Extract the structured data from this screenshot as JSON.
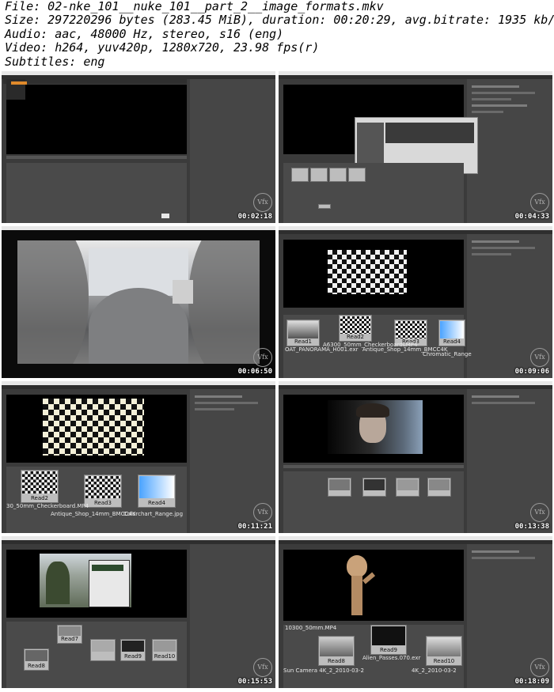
{
  "header": {
    "file": "File: 02-nke_101__nuke_101__part_2__image_formats.mkv",
    "size": "Size: 297220296 bytes (283.45 MiB), duration: 00:20:29, avg.bitrate: 1935 kb/s",
    "audio": "Audio: aac, 48000 Hz, stereo, s16 (eng)",
    "video": "Video: h264, yuv420p, 1280x720, 23.98 fps(r)",
    "subtitles": "Subtitles: eng"
  },
  "logo_text": "Vfx",
  "frames": [
    {
      "timestamp": "00:02:18"
    },
    {
      "timestamp": "00:04:33"
    },
    {
      "timestamp": "00:06:50"
    },
    {
      "timestamp": "00:09:06",
      "nodes": [
        "Read1",
        "Read2",
        "Read3",
        "Read4"
      ],
      "node_files": [
        "OAT_PANORAMA_H001.exr",
        "A6300_50mm_CheckerboardLMP4",
        "Antique_Shop_14mm_BMCC4K",
        "Chromatic_Range"
      ]
    },
    {
      "timestamp": "00:11:21",
      "nodes": [
        "Read2",
        "Read3",
        "Read4"
      ],
      "node_files": [
        "30_50mm_Checkerboard.MP4",
        "Antique_Shop_14mm_BMCC4K",
        "Colorchart_Range.jpg"
      ]
    },
    {
      "timestamp": "00:13:38"
    },
    {
      "timestamp": "00:15:53",
      "nodes": [
        "Read7",
        "Read8",
        "Read9",
        "Read10"
      ]
    },
    {
      "timestamp": "00:18:09",
      "nodes": [
        "Read8",
        "Read9",
        "Read10"
      ],
      "node_files": [
        "10300_50mm.MP4",
        "Alien_Passes.070.exr",
        "Sun Camera 4K_2_2010-03-2",
        "4K_2_2010-03-2"
      ]
    }
  ],
  "colors": {
    "panel": "#3b3b3b",
    "viewer": "#000000",
    "node_bg": "#bdbdbd",
    "accent": "#e08a2b"
  }
}
